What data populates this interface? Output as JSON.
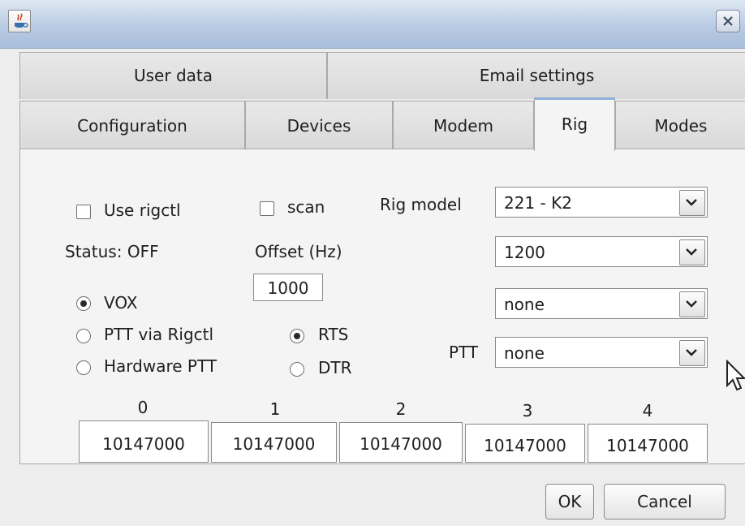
{
  "window": {
    "close_icon": "close-icon",
    "app_icon": "java-icon"
  },
  "tabs_row1": [
    "User data",
    "Email settings"
  ],
  "tabs_row2": [
    "Configuration",
    "Devices",
    "Modem",
    "Rig",
    "Modes"
  ],
  "selected_tab": "Rig",
  "rig": {
    "use_rigctl_label": "Use rigctl",
    "use_rigctl_checked": false,
    "scan_label": "scan",
    "scan_checked": false,
    "rig_model_label": "Rig model",
    "rig_model_value": "221  - K2",
    "status_label": "Status: OFF",
    "offset_label": "Offset (Hz)",
    "offset_value": "1000",
    "baud_value": "1200",
    "port_value": "none",
    "vox_label": "VOX",
    "ptt_rigctl_label": "PTT via Rigctl",
    "hardware_ptt_label": "Hardware PTT",
    "ptt_mode_selected": "VOX",
    "rts_label": "RTS",
    "dtr_label": "DTR",
    "line_selected": "RTS",
    "ptt_label": "PTT",
    "ptt_port_value": "none",
    "channel_headers": [
      "0",
      "1",
      "2",
      "3",
      "4"
    ],
    "channel_values": [
      "10147000",
      "10147000",
      "10147000",
      "10147000",
      "10147000"
    ]
  },
  "buttons": {
    "ok": "OK",
    "cancel": "Cancel"
  }
}
